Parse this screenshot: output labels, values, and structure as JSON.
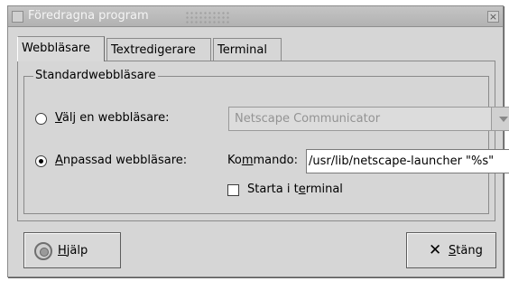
{
  "window": {
    "title": "Föredragna program",
    "close_symbol": "×"
  },
  "tabs": [
    {
      "label": "Webbläsare",
      "active": true
    },
    {
      "label": "Textredigerare",
      "active": false
    },
    {
      "label": "Terminal",
      "active": false
    }
  ],
  "group": {
    "label": "Standardwebbläsare"
  },
  "options": {
    "choose_label_mnemonic": "V",
    "choose_label_rest": "älj en webbläsare:",
    "choose_selected": false,
    "browser_combo_value": "Netscape Communicator",
    "custom_label_mnemonic": "A",
    "custom_label_rest": "npassad webbläsare:",
    "custom_selected": true,
    "command_label_prefix": "Ko",
    "command_label_mnemonic": "m",
    "command_label_rest": "mando:",
    "command_value": "/usr/lib/netscape-launcher \"%s\"",
    "terminal_label_prefix": "Starta i t",
    "terminal_label_mnemonic": "e",
    "terminal_label_rest": "rminal",
    "terminal_checked": false
  },
  "buttons": {
    "help_mnemonic": "H",
    "help_rest": "jälp",
    "help_icon": "lifebuoy-icon",
    "close_mnemonic": "S",
    "close_rest": "täng",
    "close_icon": "x-icon",
    "close_glyph": "✕"
  }
}
